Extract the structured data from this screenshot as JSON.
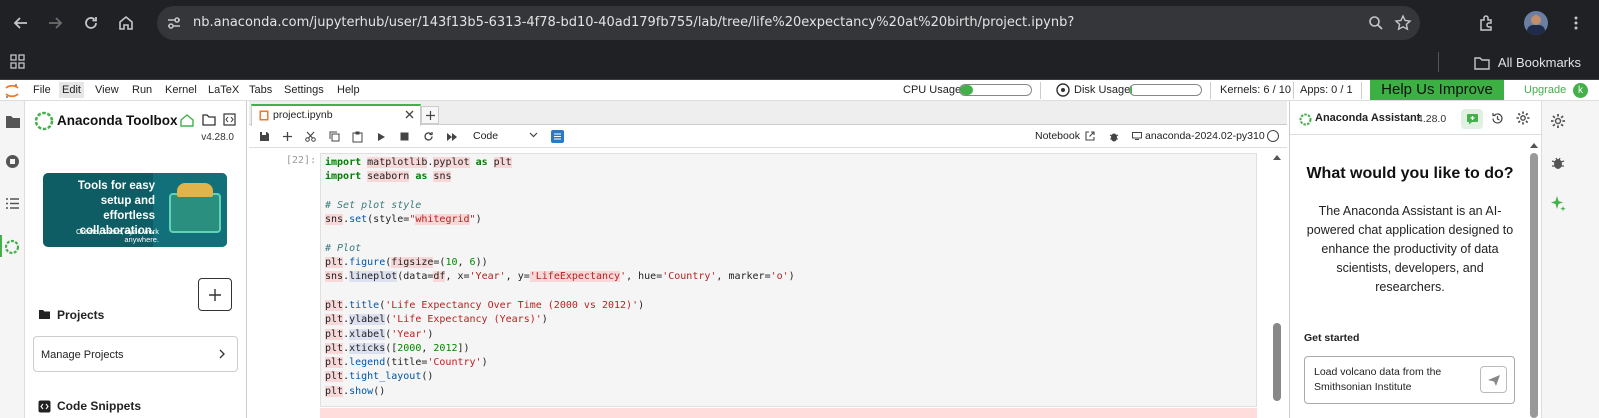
{
  "browser": {
    "url": "nb.anaconda.com/jupyterhub/user/143f13b5-6313-4f78-bd10-40ad179fb755/lab/tree/life%20expectancy%20at%20birth/project.ipynb?",
    "bookmarks_label": "All Bookmarks"
  },
  "menu": [
    "File",
    "Edit",
    "View",
    "Run",
    "Kernel",
    "LaTeX",
    "Tabs",
    "Settings",
    "Help"
  ],
  "status": {
    "cpu_label": "CPU Usage",
    "cpu_fraction": 0.18,
    "disk_label": "Disk Usage",
    "disk_fraction": 0.03,
    "kernels": "Kernels: 6 / 10",
    "apps": "Apps: 0 / 1",
    "help_improve": "Help Us Improve",
    "upgrade": "Upgrade",
    "avatar_letter": "k"
  },
  "toolbox": {
    "title": "Anaconda Toolbox",
    "version": "v4.28.0",
    "banner_title": "Tools for easy setup and effortless collaboration.",
    "banner_sub": "Create, share, sync work anywhere.",
    "projects_heading": "Projects",
    "manage_projects": "Manage Projects",
    "snippets_heading": "Code Snippets"
  },
  "notebook": {
    "tab_name": "project.ipynb",
    "cell_type": "Code",
    "notebook_label": "Notebook",
    "kernel_name": "anaconda-2024.02-py310",
    "exec_count": "[22]:"
  },
  "assistant": {
    "title": "Anaconda Assistant",
    "version": "4.28.0",
    "heading": "What would you like to do?",
    "description": "The Anaconda Assistant is an AI-powered chat application designed to enhance the productivity of data scientists, developers, and researchers.",
    "get_started": "Get started",
    "suggestion": "Load volcano data from the Smithsonian Institute"
  },
  "colors": {
    "accent_green": "#43b049",
    "chrome_bg": "#202124",
    "help_bg": "#3cb043"
  }
}
